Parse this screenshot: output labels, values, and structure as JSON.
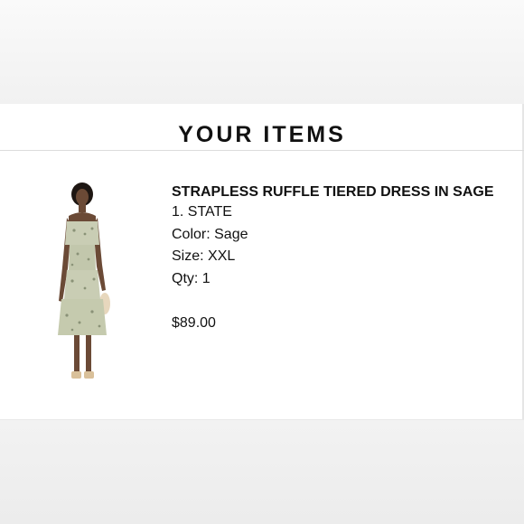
{
  "section": {
    "title": "YOUR ITEMS"
  },
  "item": {
    "name": "STRAPLESS RUFFLE TIERED DRESS IN SAGE",
    "brand": "1. STATE",
    "color_line": "Color: Sage",
    "size_line": "Size: XXL",
    "qty_line": "Qty: 1",
    "price": "$89.00",
    "image_icon": "dress-photo",
    "colors": {
      "dress": "#c9cdb4",
      "print": "#8a9277",
      "skin": "#6b4a36",
      "hair": "#1e1713",
      "bag": "#e7d7bd"
    }
  }
}
